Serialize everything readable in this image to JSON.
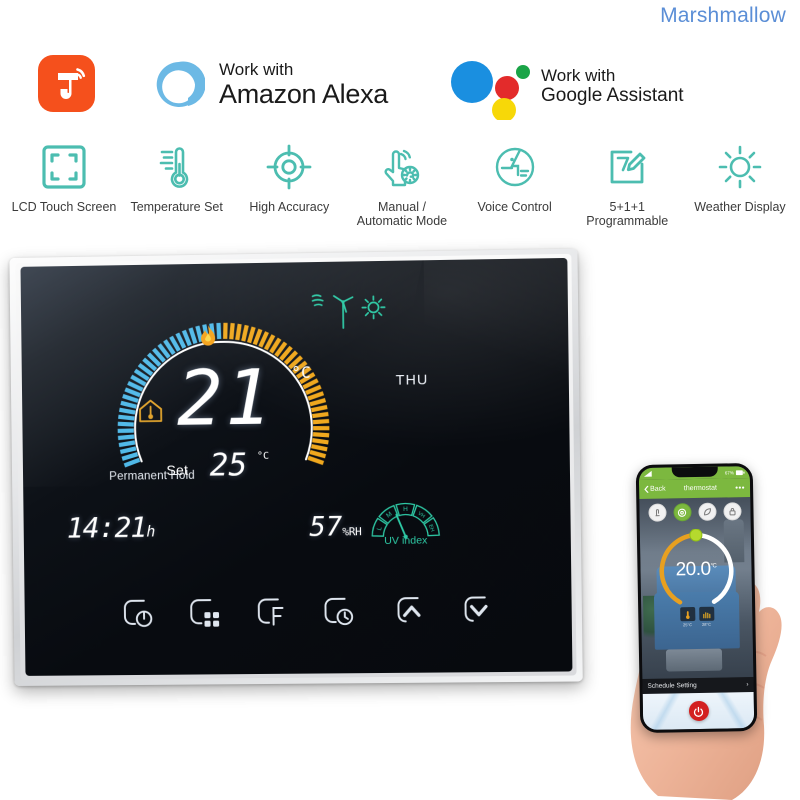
{
  "brand": {
    "name": "Marshmallow",
    "color": "#5b8ed6"
  },
  "badges": {
    "tuya": {
      "icon": "tuya-logo-icon",
      "color": "#f5501c"
    },
    "alexa": {
      "line1": "Work with",
      "line2": "Amazon Alexa",
      "ring_color": "#6cb9e5"
    },
    "google": {
      "line1": "Work with",
      "line2": "Google Assistant",
      "dot_colors": [
        "#1a8fe0",
        "#e32b2b",
        "#1aa447",
        "#f7d808"
      ]
    }
  },
  "features": [
    {
      "label": "LCD Touch Screen",
      "icon": "lcd-touch-screen-icon"
    },
    {
      "label": "Temperature Set",
      "icon": "thermometer-icon"
    },
    {
      "label": "High Accuracy",
      "icon": "crosshair-target-icon"
    },
    {
      "label": "Manual /\nAutomatic Mode",
      "icon": "hand-tap-gear-icon"
    },
    {
      "label": "Voice Control",
      "icon": "voice-control-icon"
    },
    {
      "label": "5+1+1\nProgrammable",
      "icon": "calendar-pencil-icon"
    },
    {
      "label": "Weather Display",
      "icon": "sun-icon"
    }
  ],
  "feature_icon_color": "#4cbdb0",
  "thermostat": {
    "current_temp": "21",
    "current_temp_unit": "°C",
    "set_label": "Set",
    "set_temp": "25",
    "set_temp_unit": "°C",
    "mode_text": "Permanent Hold",
    "day": "THU",
    "clock": "14:21",
    "clock_suffix": "h",
    "humidity": "57",
    "humidity_unit": "%RH",
    "uv_caption": "UV index",
    "uv_segments": [
      "L",
      "M",
      "H",
      "VH",
      "EH"
    ],
    "uv_level_index": 2,
    "dial_colors": {
      "cool": "#4fb9e8",
      "heat": "#f0a81e",
      "ring": "#ffffff"
    },
    "status_icons": [
      {
        "name": "flame-heating-icon",
        "color": "#f5a31a"
      },
      {
        "name": "house-temperature-icon",
        "color": "#e0a22a"
      },
      {
        "name": "wind-turbine-icon",
        "color": "#2ec9a5"
      },
      {
        "name": "sun-weather-icon",
        "color": "#2ec9a5"
      }
    ],
    "touch_buttons": [
      {
        "name": "power-button",
        "icon": "power-icon",
        "label": ""
      },
      {
        "name": "menu-button",
        "icon": "grid-menu-icon",
        "label": ""
      },
      {
        "name": "fahrenheit-button",
        "icon": "fahrenheit-icon",
        "label": "F"
      },
      {
        "name": "timer-button",
        "icon": "clock-icon",
        "label": ""
      },
      {
        "name": "up-button",
        "icon": "chevron-up-icon",
        "label": ""
      },
      {
        "name": "down-button",
        "icon": "chevron-down-icon",
        "label": ""
      }
    ]
  },
  "phone_app": {
    "status_battery": "67%",
    "back_label": "Back",
    "title": "thermostat",
    "overflow": "•••",
    "temperature": "20.0",
    "temperature_unit": "°C",
    "schedule_label": "Schedule Setting",
    "schedule_chevron": "›",
    "accent_color": "#7cb83f",
    "arc_color": "#e8a020",
    "power_color": "#d32020",
    "tool_icons": [
      {
        "name": "hand-mode-icon",
        "active": false
      },
      {
        "name": "auto-mode-icon",
        "active": true
      },
      {
        "name": "eco-leaf-icon",
        "active": false
      },
      {
        "name": "lock-icon",
        "active": false
      }
    ],
    "mini_modes": [
      {
        "name": "cool-mode-mini",
        "label": "25°C"
      },
      {
        "name": "heat-mode-mini",
        "label": "28°C"
      }
    ]
  }
}
